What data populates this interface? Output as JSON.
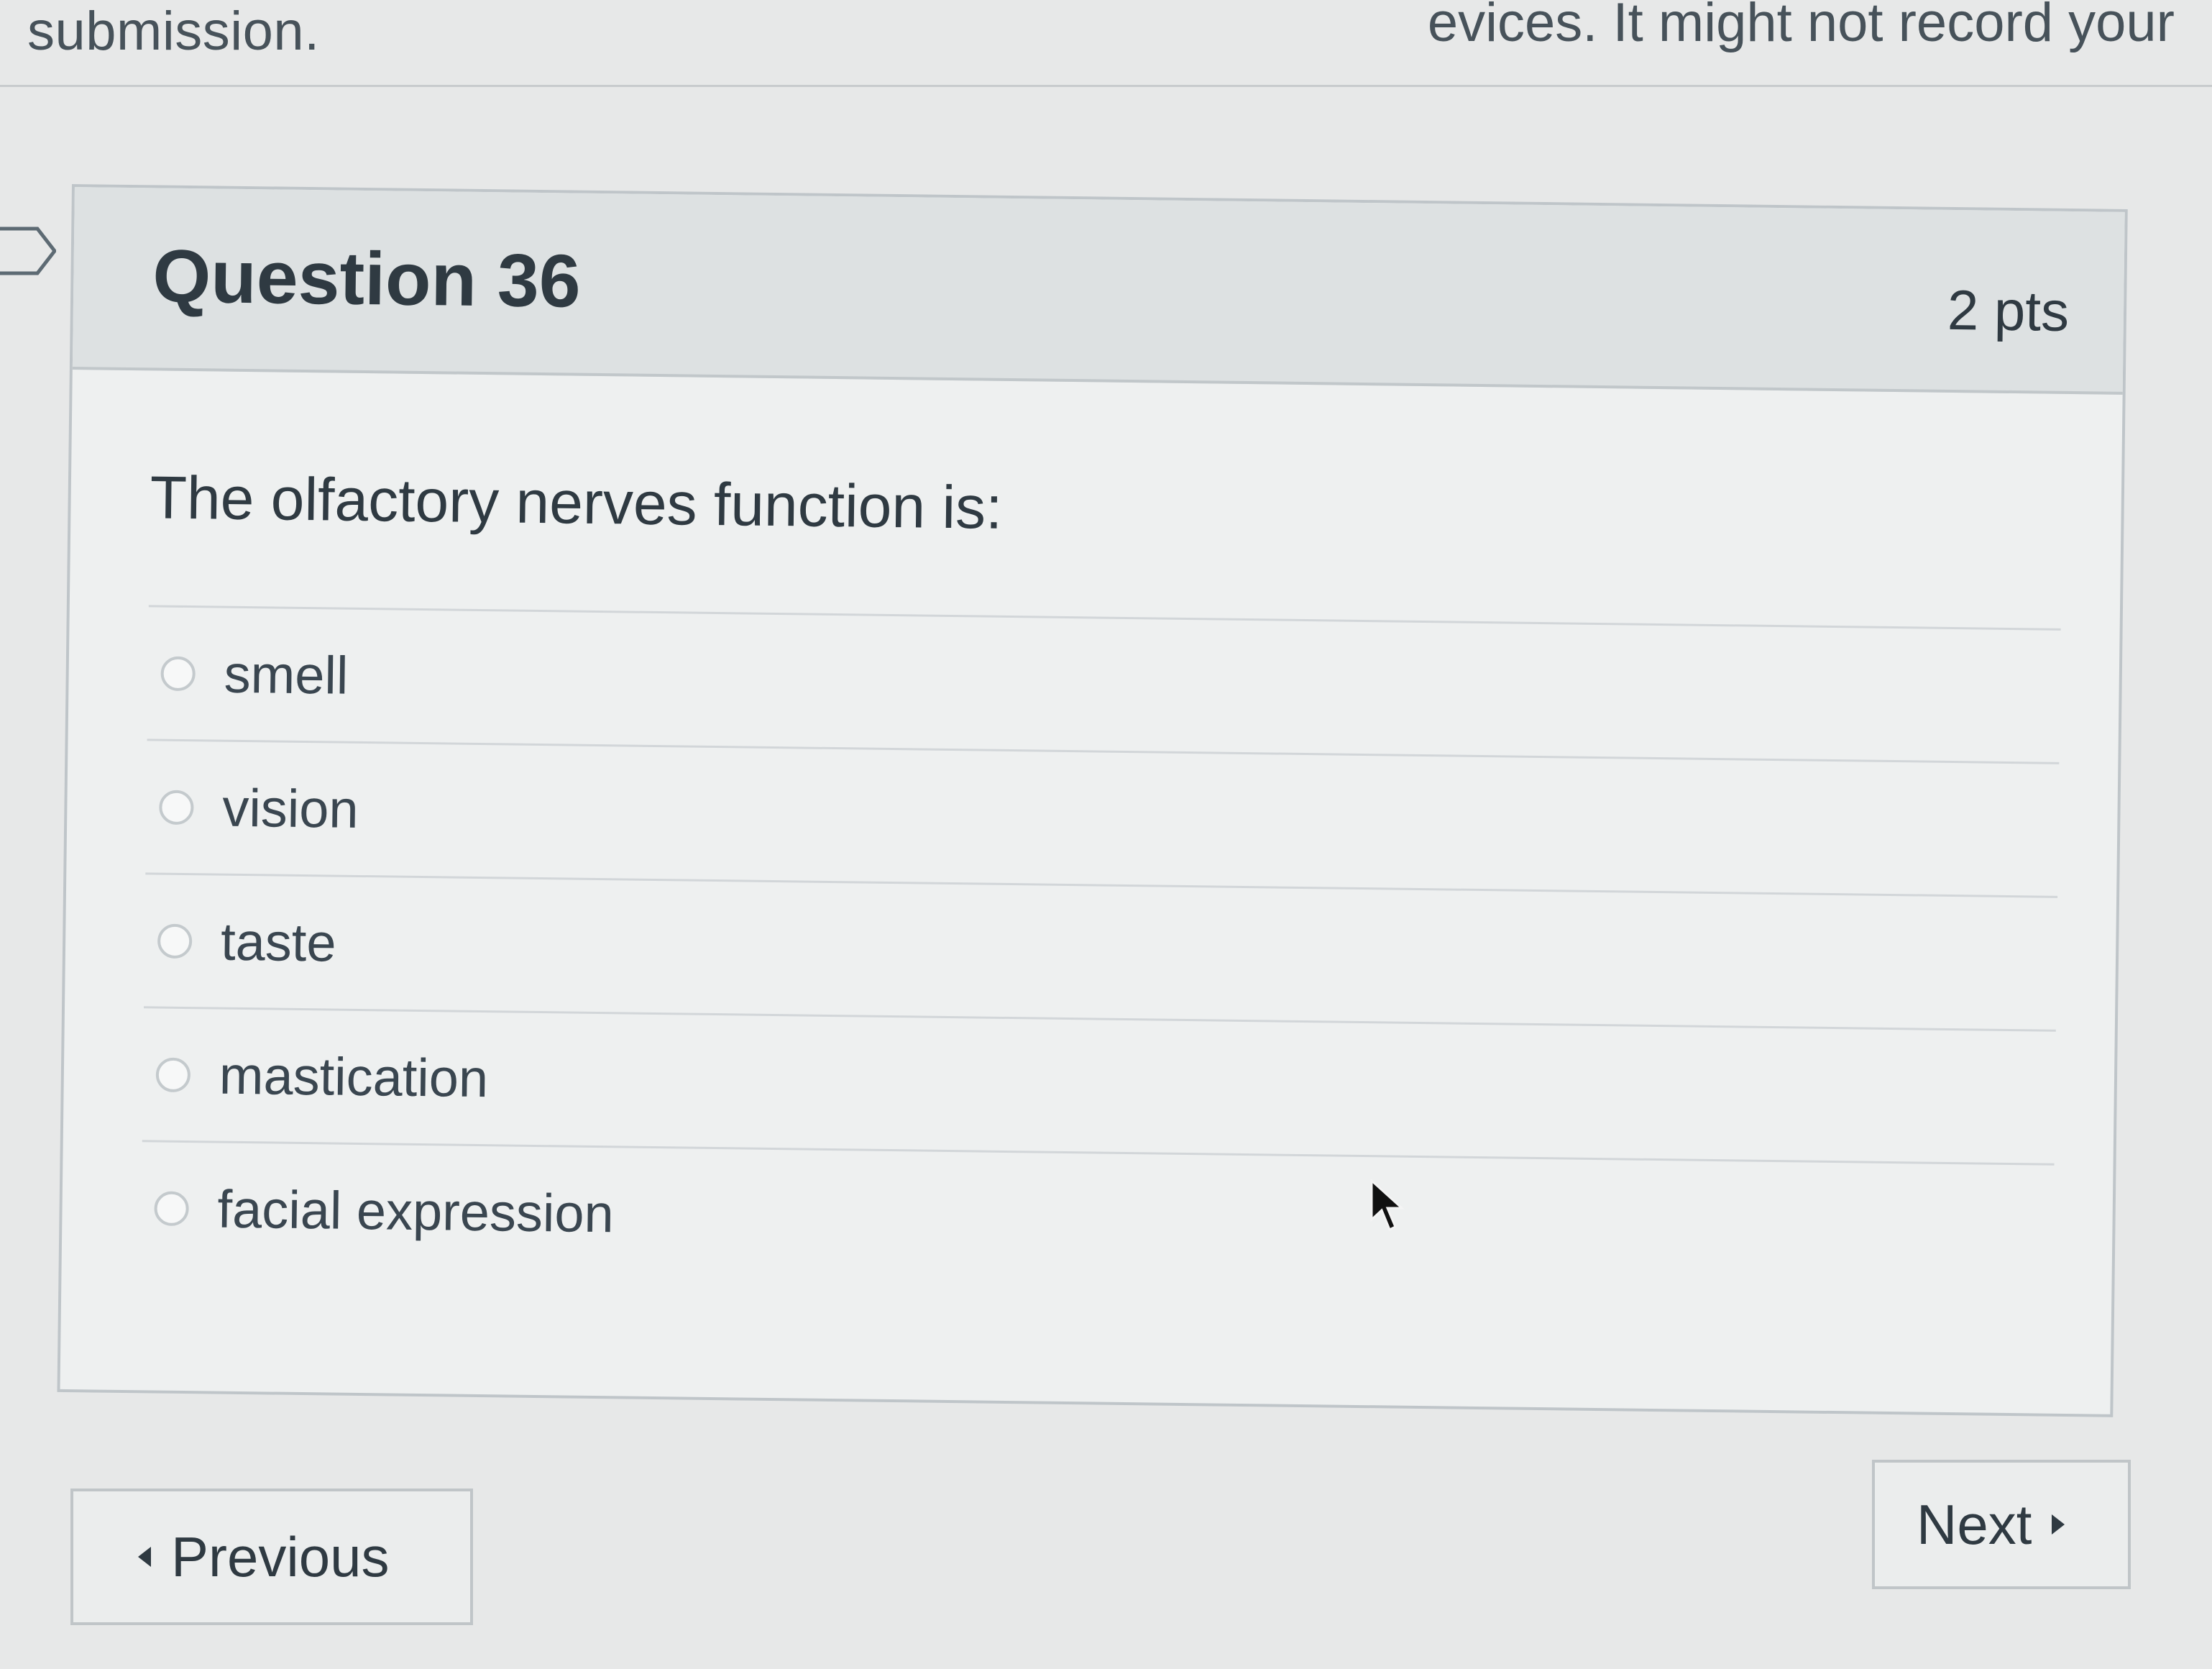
{
  "page": {
    "top_left_text": "submission.",
    "top_right_text": "evices. It might not record your"
  },
  "question": {
    "title": "Question 36",
    "points": "2 pts",
    "text": "The olfactory nerves function is:",
    "answers": [
      {
        "label": "smell"
      },
      {
        "label": "vision"
      },
      {
        "label": "taste"
      },
      {
        "label": "mastication"
      },
      {
        "label": "facial expression"
      }
    ]
  },
  "navigation": {
    "previous_label": "Previous",
    "next_label": "Next"
  },
  "icons": {
    "question_flag": "bookmark-icon",
    "previous_arrow": "chevron-left-icon",
    "next_arrow": "chevron-right-icon",
    "cursor": "mouse-cursor-icon"
  },
  "colors": {
    "background": "#e7e8e8",
    "card": "#eef0f0",
    "header": "#dde1e2",
    "text": "#2f3a42"
  }
}
